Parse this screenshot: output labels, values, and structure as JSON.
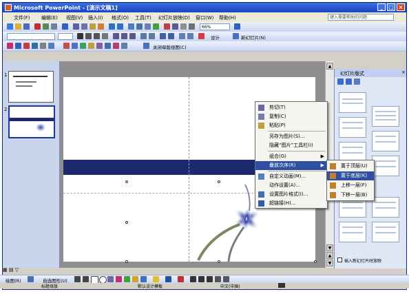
{
  "window": {
    "title": "Microsoft PowerPoint - [演示文稿1]",
    "controls": [
      "_",
      "□",
      "×"
    ]
  },
  "menubar": {
    "items": [
      "文件(F)",
      "编辑(E)",
      "视图(V)",
      "插入(I)",
      "格式(O)",
      "工具(T)",
      "幻灯片放映(D)",
      "窗口(W)",
      "帮助(H)"
    ],
    "help_placeholder": "键入需要帮助的问题"
  },
  "toolbar_std": {
    "zoom": "66%"
  },
  "toolbar_fmt": {
    "design_label": "设计",
    "new_slide_label": "新幻灯片(N)"
  },
  "toolbar_third": {
    "close_master_label": "关闭母版视图(C)"
  },
  "thumbs": [
    {
      "num": "1"
    },
    {
      "num": "2"
    }
  ],
  "task_pane": {
    "title": "幻灯片版式",
    "checkbox_label": "插入新幻灯片时放映",
    "colors": {
      "header": "#c2cff0"
    }
  },
  "context_menu": {
    "items": [
      {
        "label": "剪切(T)",
        "icon": "cut-icon"
      },
      {
        "label": "复制(C)",
        "icon": "copy-icon"
      },
      {
        "label": "粘贴(P)",
        "icon": "paste-icon"
      },
      {
        "label": "另存为图片(S)...",
        "icon": ""
      },
      {
        "label": "隐藏“图片”工具栏(I)",
        "icon": ""
      },
      {
        "label": "组合(G)",
        "icon": ""
      },
      {
        "label": "叠放次序(R)",
        "icon": ""
      },
      {
        "label": "自定义动画(M)...",
        "icon": "animation-icon"
      },
      {
        "label": "动作设置(A)...",
        "icon": ""
      },
      {
        "label": "设置图片格式(I)...",
        "icon": "format-picture-icon"
      },
      {
        "label": "超链接(H)...",
        "icon": "hyperlink-icon"
      }
    ]
  },
  "submenu": {
    "items": [
      {
        "label": "置于顶层(U)",
        "icon": "bring-front-icon"
      },
      {
        "label": "置于底层(K)",
        "icon": "send-back-icon"
      },
      {
        "label": "上移一层(F)",
        "icon": "forward-icon"
      },
      {
        "label": "下移一层(B)",
        "icon": "backward-icon"
      }
    ]
  },
  "drawbar": {
    "draw_label": "绘图(R)",
    "autoshape_label": "自选图形(U)"
  },
  "status": {
    "view": "标题母版",
    "design": "默认设计模板",
    "lang": "中文(中国)"
  },
  "colors": {
    "band": "#1f2a6e",
    "highlight": "#2f4fa0",
    "title_bar": "#1842c2"
  }
}
